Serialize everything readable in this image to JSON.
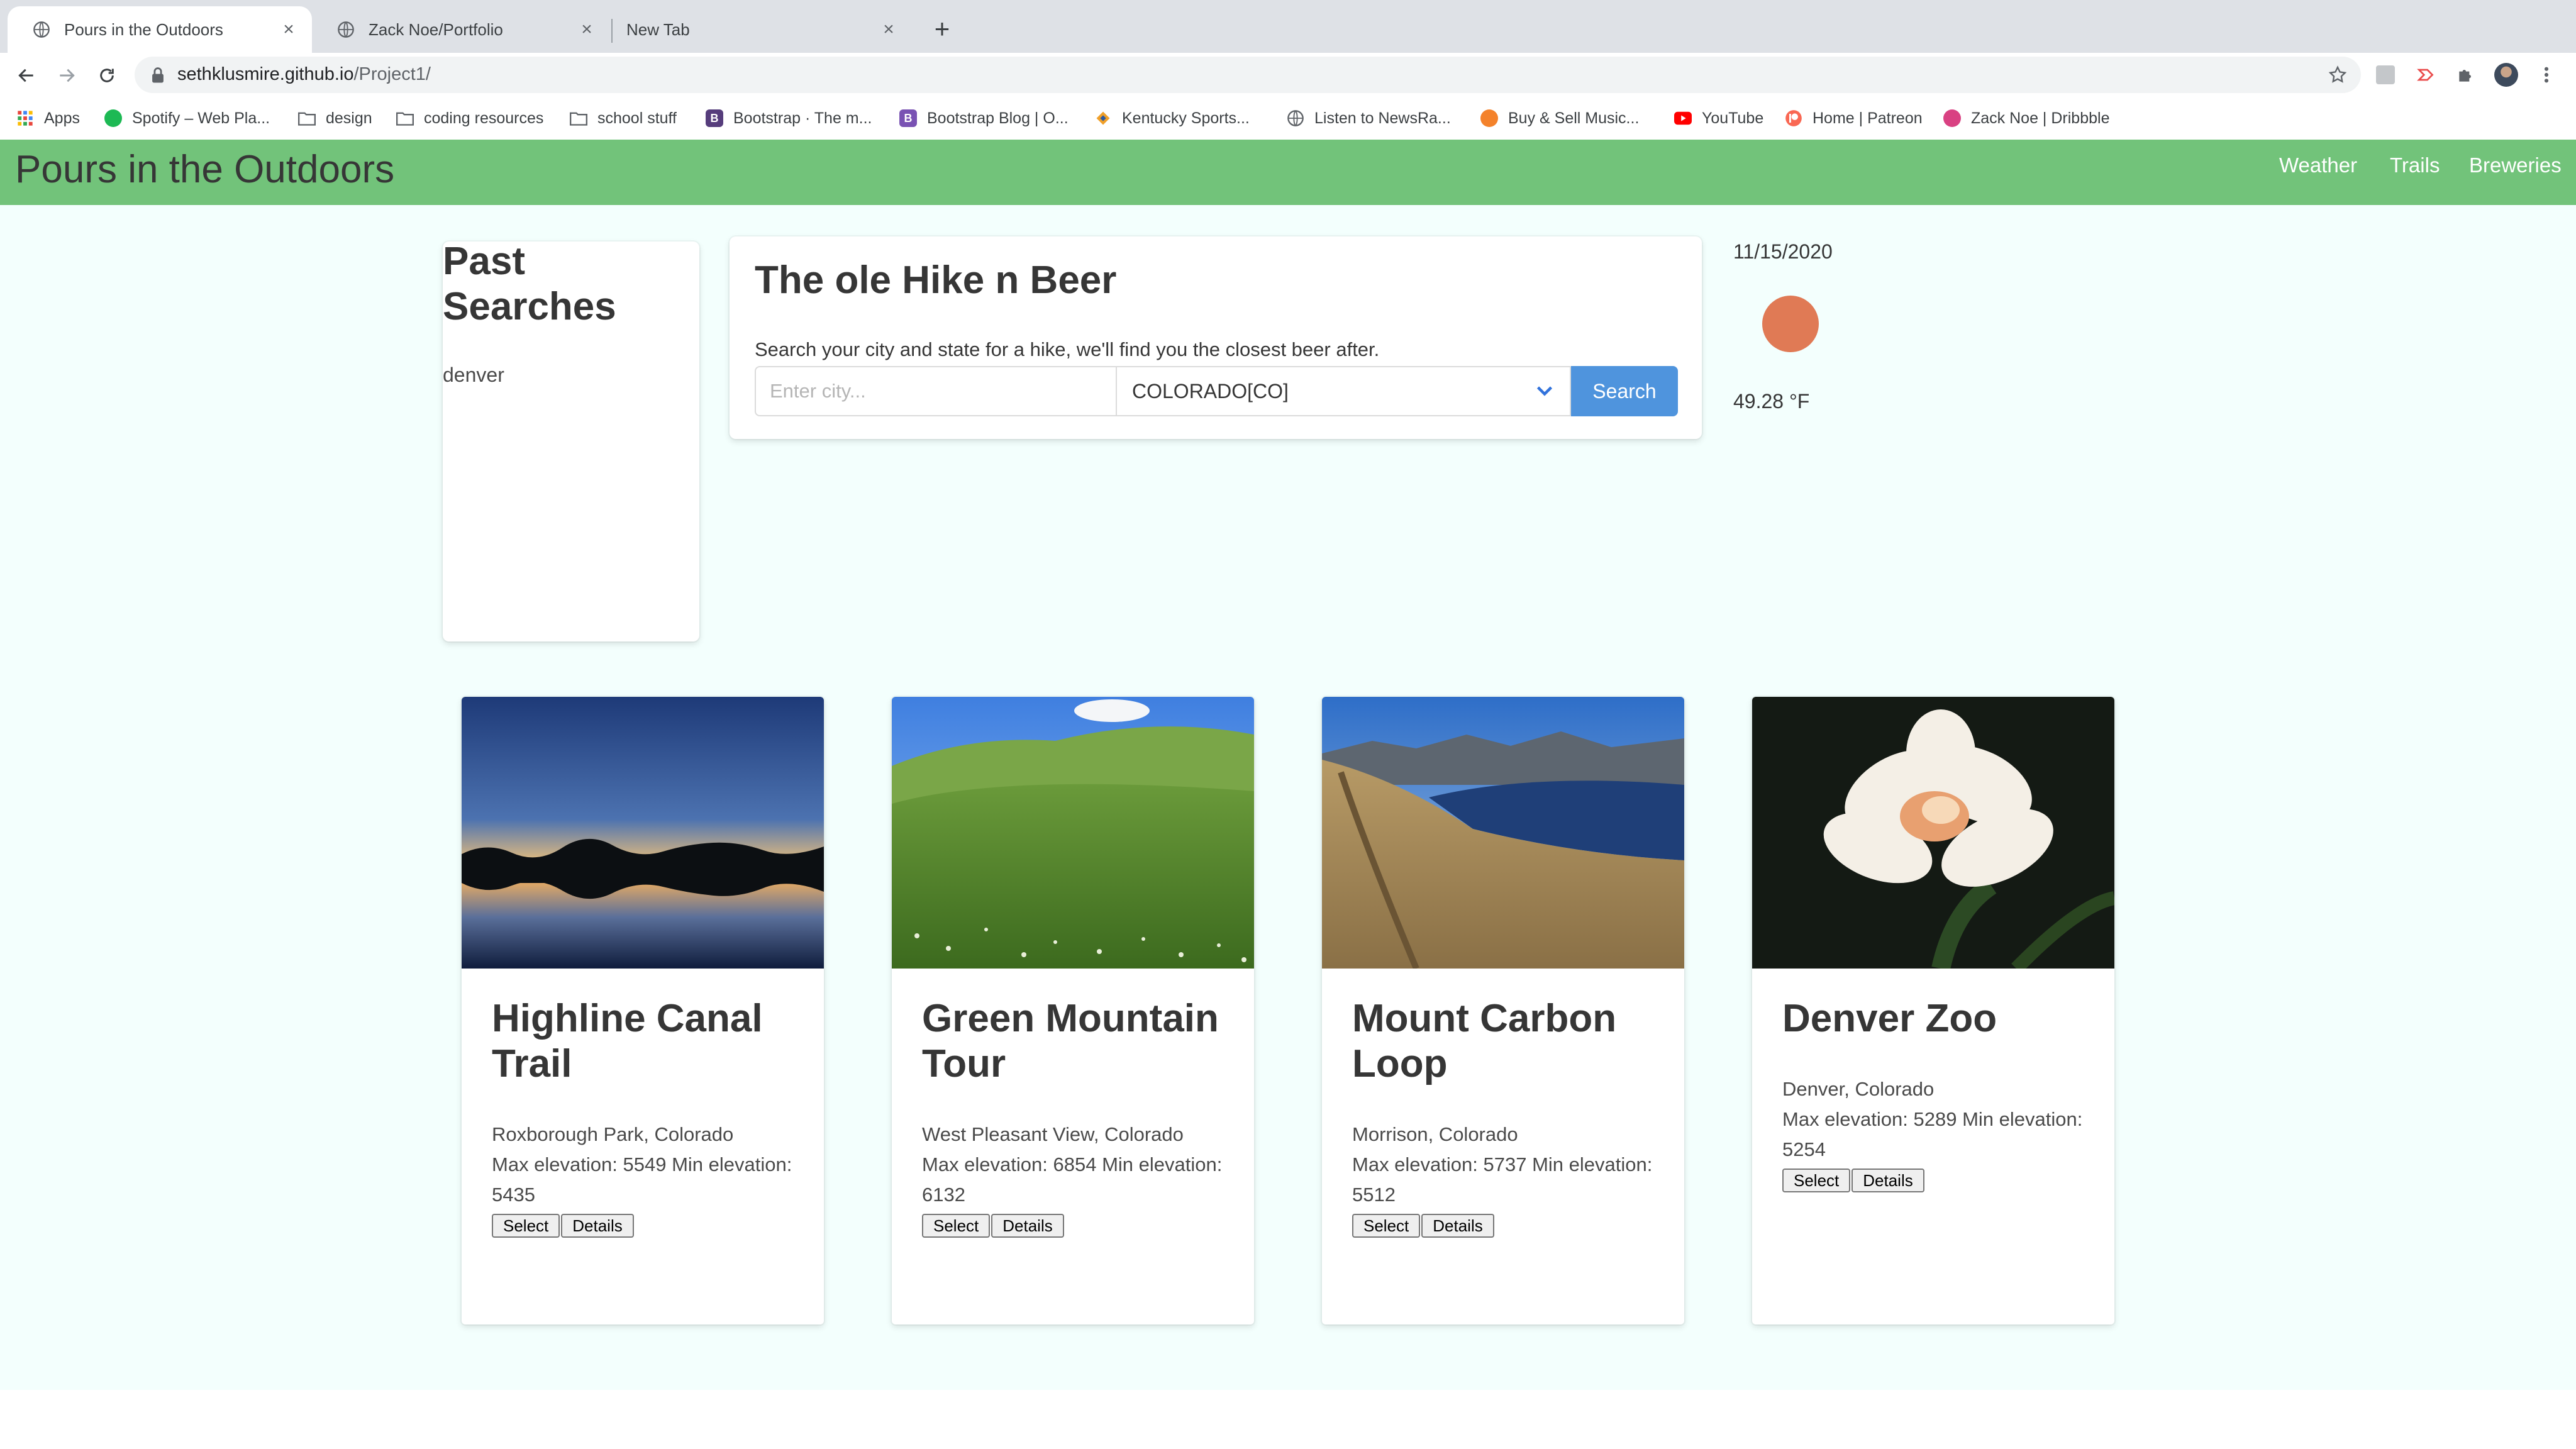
{
  "browser": {
    "tabs": [
      {
        "title": "Pours in the Outdoors",
        "active": true
      },
      {
        "title": "Zack Noe/Portfolio",
        "active": false
      },
      {
        "title": "New Tab",
        "active": false
      }
    ],
    "url_host": "sethklusmire.github.io",
    "url_path": "/Project1/",
    "bookmarks": [
      {
        "label": "Apps",
        "icon": "apps-grid-icon"
      },
      {
        "label": "Spotify – Web Pla...",
        "icon": "spotify-icon"
      },
      {
        "label": "design",
        "icon": "folder-icon"
      },
      {
        "label": "coding resources",
        "icon": "folder-icon"
      },
      {
        "label": "school stuff",
        "icon": "folder-icon"
      },
      {
        "label": "Bootstrap · The m...",
        "icon": "bootstrap-icon"
      },
      {
        "label": "Bootstrap Blog | O...",
        "icon": "bootstrap-icon"
      },
      {
        "label": "Kentucky Sports...",
        "icon": "ksr-icon"
      },
      {
        "label": "Listen to NewsRa...",
        "icon": "globe-icon"
      },
      {
        "label": "Buy & Sell Music...",
        "icon": "reverb-icon"
      },
      {
        "label": "YouTube",
        "icon": "youtube-icon"
      },
      {
        "label": "Home | Patreon",
        "icon": "patreon-icon"
      },
      {
        "label": "Zack Noe | Dribbble",
        "icon": "dribbble-icon"
      }
    ]
  },
  "navbar": {
    "brand": "Pours in the Outdoors",
    "links": [
      "Weather",
      "Trails",
      "Breweries"
    ],
    "color": "#72c37a"
  },
  "past_searches": {
    "title": "Past Searches",
    "items": [
      "denver"
    ]
  },
  "search": {
    "title": "The ole Hike n Beer",
    "description": "Search your city and state for a hike, we'll find you the closest beer after.",
    "city_placeholder": "Enter city...",
    "city_value": "",
    "state_selected": "COLORADO[CO]",
    "button_label": "Search",
    "button_color": "#4f94dd"
  },
  "weather": {
    "date": "11/15/2020",
    "temperature": "49.28 °F",
    "icon_color": "#e07a55"
  },
  "trails": [
    {
      "name": "Highline Canal Trail",
      "location": "Roxborough Park, Colorado",
      "elevation": "Max elevation: 5549 Min elevation: 5435",
      "image": "sunset-lake-image",
      "select_label": "Select",
      "details_label": "Details"
    },
    {
      "name": "Green Mountain Tour",
      "location": "West Pleasant View, Colorado",
      "elevation": "Max elevation: 6854 Min elevation: 6132",
      "image": "green-meadow-image",
      "select_label": "Select",
      "details_label": "Details"
    },
    {
      "name": "Mount Carbon Loop",
      "location": "Morrison, Colorado",
      "elevation": "Max elevation: 5737 Min elevation: 5512",
      "image": "reservoir-trail-image",
      "select_label": "Select",
      "details_label": "Details"
    },
    {
      "name": "Denver Zoo",
      "location": "Denver, Colorado",
      "elevation": "Max elevation: 5289 Min elevation: 5254",
      "image": "white-flower-image",
      "select_label": "Select",
      "details_label": "Details"
    }
  ]
}
